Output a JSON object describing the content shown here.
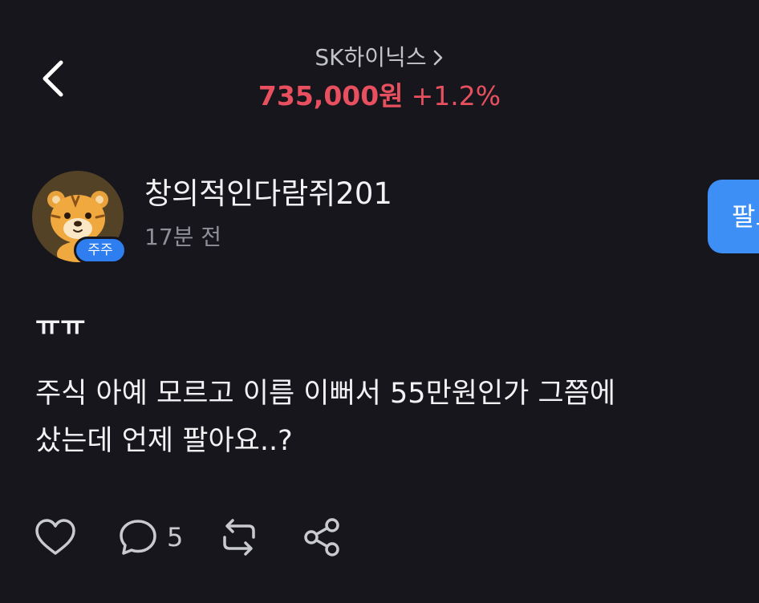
{
  "header": {
    "stock_name": "SK하이닉스",
    "price": "735,000원",
    "change": "+1.2%",
    "price_color": "#e85060"
  },
  "post": {
    "author": "창의적인다람쥐201",
    "badge": "주주",
    "time": "17분 전",
    "follow_label": "팔로우",
    "title": "ㅠㅠ",
    "body_line1": "주식 아예 모르고 이름 이뻐서 55만원인가 그쯤에",
    "body_line2": "샀는데 언제 팔아요..?"
  },
  "actions": {
    "comment_count": "5",
    "icons": [
      "heart-icon",
      "comment-icon",
      "repost-icon",
      "share-icon"
    ]
  },
  "colors": {
    "background": "#16161c",
    "accent": "#3e8ff5",
    "price": "#e85060"
  }
}
